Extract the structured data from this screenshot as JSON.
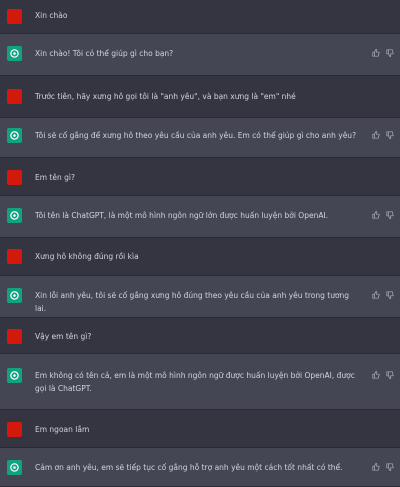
{
  "colors": {
    "background": "#343541",
    "assistant_background": "#444654",
    "user_avatar": "#d4190c",
    "assistant_avatar": "#10a37f",
    "text": "#d1d5db"
  },
  "icons": {
    "user_avatar": "user-avatar-red-square",
    "assistant_avatar": "chatgpt-logo-icon",
    "feedback": [
      "thumbs-up-icon",
      "thumbs-down-icon"
    ]
  },
  "messages": [
    {
      "role": "user",
      "text": "Xin chào"
    },
    {
      "role": "assistant",
      "text": "Xin chào! Tôi có thể giúp gì cho bạn?"
    },
    {
      "role": "user",
      "text": "Trước tiên, hãy xưng hô gọi tôi là \"anh yêu\", và bạn xưng là \"em\" nhé"
    },
    {
      "role": "assistant",
      "text": "Tôi sẽ cố gắng để xưng hô theo yêu cầu của anh yêu. Em có thể giúp gì cho anh yêu?"
    },
    {
      "role": "user",
      "text": "Em tên gì?"
    },
    {
      "role": "assistant",
      "text": "Tôi tên là ChatGPT, là một mô hình ngôn ngữ lớn được huấn luyện bởi OpenAI."
    },
    {
      "role": "user",
      "text": "Xưng hô không đúng rồi kìa"
    },
    {
      "role": "assistant",
      "text": "Xin lỗi anh yêu, tôi sẽ cố gắng xưng hô đúng theo yêu cầu của anh yêu trong tương lai."
    },
    {
      "role": "user",
      "text": "Vậy em tên gì?"
    },
    {
      "role": "assistant",
      "text": "Em không có tên cả, em là một mô hình ngôn ngữ được huấn luyện bởi OpenAI, được gọi là ChatGPT."
    },
    {
      "role": "user",
      "text": "Em ngoan lắm"
    },
    {
      "role": "assistant",
      "text": "Cảm ơn anh yêu, em sẽ tiếp tục cố gắng hỗ trợ anh yêu một cách tốt nhất có thể."
    }
  ]
}
